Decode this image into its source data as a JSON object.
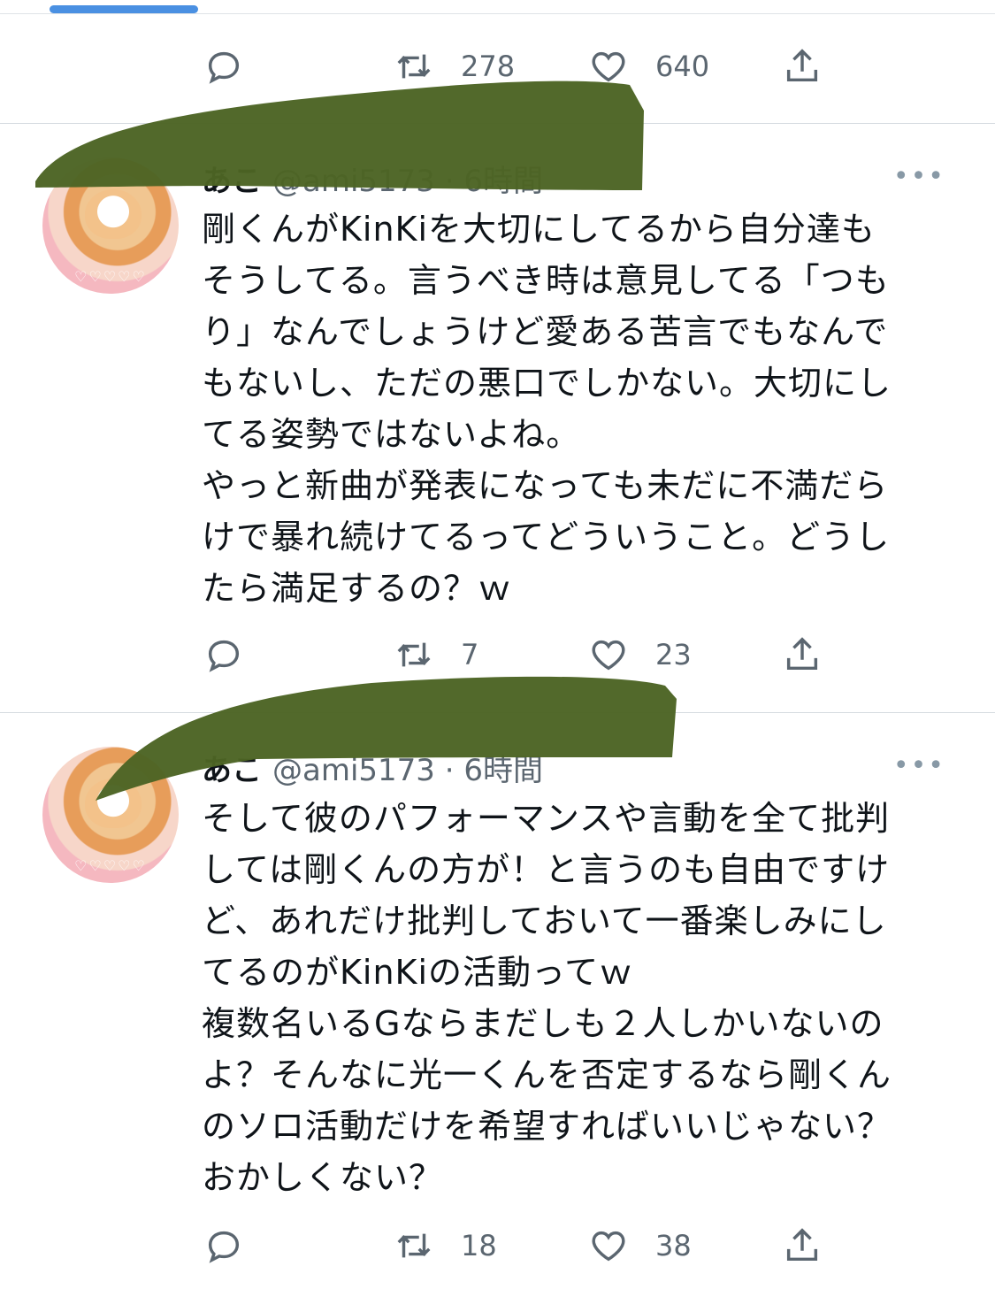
{
  "colors": {
    "accent": "#4a90e2",
    "text": "#0f1419",
    "secondary": "#5b6670",
    "redaction": "#4c6424"
  },
  "top_actions": {
    "reply_count": "",
    "retweet_count": "278",
    "like_count": "640"
  },
  "tweets": [
    {
      "display_name": "あこ",
      "handle": "@ami5173",
      "time": "· 6時間",
      "more": "•••",
      "lines": [
        "剛くんがKinKiを大切にしてるから自分達も",
        "そうしてる。言うべき時は意見してる「つも",
        "り」なんでしょうけど愛ある苦言でもなんで",
        "もないし、ただの悪口でしかない。大切にし",
        "てる姿勢ではないよね。",
        "やっと新曲が発表になっても未だに不満だら",
        "けで暴れ続けてるってどういうこと。どうし",
        "たら満足するの？ｗ"
      ],
      "retweet_count": "7",
      "like_count": "23"
    },
    {
      "display_name": "あこ",
      "handle": "@ami5173",
      "time": "· 6時間",
      "more": "•••",
      "lines": [
        "そして彼のパフォーマンスや言動を全て批判",
        "しては剛くんの方が！と言うのも自由ですけ",
        "ど、あれだけ批判しておいて一番楽しみにし",
        "てるのがKinKiの活動ってｗ",
        "複数名いるGならまだしも２人しかいないの",
        "よ？そんなに光一くんを否定するなら剛くん",
        "のソロ活動だけを希望すればいいじゃない？",
        "おかしくない？"
      ],
      "retweet_count": "18",
      "like_count": "38"
    }
  ],
  "icons": {
    "reply": "reply-icon",
    "retweet": "retweet-icon",
    "like": "heart-icon",
    "share": "share-icon",
    "more": "more-icon"
  }
}
